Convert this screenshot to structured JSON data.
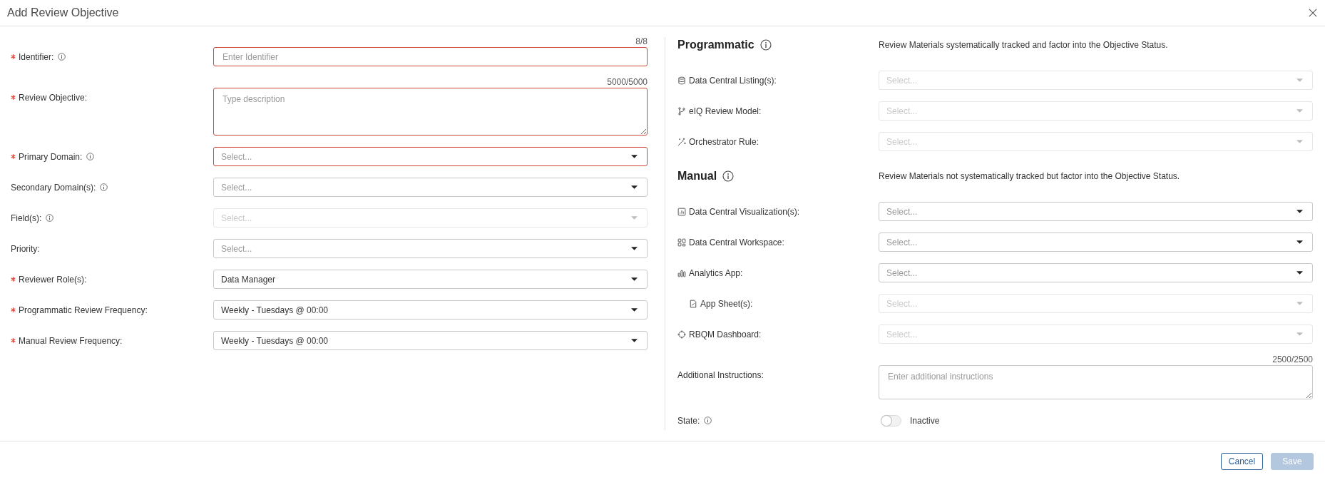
{
  "dialog": {
    "title": "Add Review Objective"
  },
  "left_fields": [
    {
      "kind": "text",
      "label": "Identifier:",
      "required": true,
      "info": true,
      "counter": "8/8",
      "placeholder": "Enter Identifier",
      "error": true,
      "disabled": false
    },
    {
      "kind": "textarea",
      "label": "Review Objective:",
      "required": true,
      "info": false,
      "counter": "5000/5000",
      "placeholder": "Type description",
      "error": true,
      "disabled": false
    },
    {
      "kind": "select",
      "label": "Primary Domain:",
      "required": true,
      "info": true,
      "placeholder": "Select...",
      "error": true,
      "disabled": false
    },
    {
      "kind": "select",
      "label": "Secondary Domain(s):",
      "required": false,
      "info": true,
      "placeholder": "Select...",
      "error": false,
      "disabled": false
    },
    {
      "kind": "select",
      "label": "Field(s):",
      "required": false,
      "info": true,
      "placeholder": "Select...",
      "error": false,
      "disabled": true
    },
    {
      "kind": "select",
      "label": "Priority:",
      "required": false,
      "info": false,
      "placeholder": "Select...",
      "error": false,
      "disabled": false
    },
    {
      "kind": "select",
      "label": "Reviewer Role(s):",
      "required": true,
      "info": false,
      "value": "Data Manager",
      "error": false,
      "disabled": false
    },
    {
      "kind": "select",
      "label": "Programmatic Review Frequency:",
      "required": true,
      "info": false,
      "value": "Weekly - Tuesdays @ 00:00",
      "error": false,
      "disabled": false
    },
    {
      "kind": "select",
      "label": "Manual Review Frequency:",
      "required": true,
      "info": false,
      "value": "Weekly - Tuesdays @ 00:00",
      "error": false,
      "disabled": false
    }
  ],
  "right_panel": {
    "sections": [
      {
        "title": "Programmatic",
        "info": true,
        "description": "Review Materials systematically tracked and factor into the Objective Status.",
        "fields": [
          {
            "label": "Data Central Listing(s):",
            "placeholder": "Select...",
            "disabled": true
          },
          {
            "label": "eIQ Review Model:",
            "placeholder": "Select...",
            "disabled": true
          },
          {
            "label": "Orchestrator Rule:",
            "placeholder": "Select...",
            "disabled": true
          }
        ]
      },
      {
        "title": "Manual",
        "info": true,
        "description": "Review Materials not systematically tracked but factor into the Objective Status.",
        "fields": [
          {
            "label": "Data Central Visualization(s):",
            "placeholder": "Select...",
            "disabled": false
          },
          {
            "label": "Data Central Workspace:",
            "placeholder": "Select...",
            "disabled": false
          },
          {
            "label": "Analytics App:",
            "placeholder": "Select...",
            "disabled": false,
            "children": [
              {
                "label": "App Sheet(s):",
                "placeholder": "Select...",
                "disabled": true
              }
            ]
          },
          {
            "label": "RBQM Dashboard:",
            "placeholder": "Select...",
            "disabled": true
          }
        ]
      }
    ],
    "additional_instructions": {
      "label": "Additional Instructions:",
      "counter": "2500/2500",
      "placeholder": "Enter additional instructions"
    },
    "state": {
      "label": "State:",
      "info": true,
      "on": false,
      "value": "Inactive"
    }
  },
  "footer": {
    "buttons": [
      {
        "label": "Cancel",
        "kind": "secondary",
        "disabled": false
      },
      {
        "label": "Save",
        "kind": "primary",
        "disabled": true
      }
    ]
  }
}
